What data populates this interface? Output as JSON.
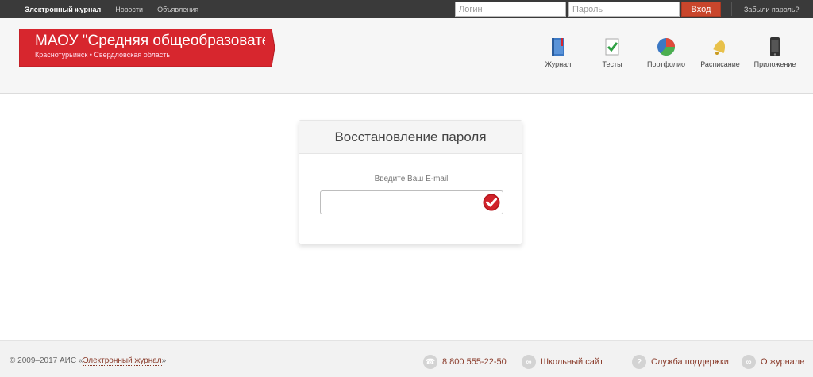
{
  "topbar": {
    "nav": [
      "Электронный журнал",
      "Новости",
      "Объявления"
    ],
    "login_placeholder": "Логин",
    "password_placeholder": "Пароль",
    "enter_label": "Вход",
    "forgot_label": "Забыли пароль?"
  },
  "header": {
    "school_title": "МАОУ \"Средняя общеобразовательная школа",
    "school_location": "Краснотурьинск • Свердловская область",
    "menu": [
      {
        "label": "Журнал",
        "icon": "journal-icon"
      },
      {
        "label": "Тесты",
        "icon": "tests-icon"
      },
      {
        "label": "Портфолио",
        "icon": "portfolio-icon"
      },
      {
        "label": "Расписание",
        "icon": "schedule-bell-icon"
      },
      {
        "label": "Приложение",
        "icon": "phone-app-icon"
      }
    ]
  },
  "recovery": {
    "title": "Восстановление пароля",
    "email_label": "Введите Ваш E-mail",
    "email_value": ""
  },
  "footer": {
    "copyright_prefix": "© 2009–2017 АИС «",
    "copyright_link": "Электронный журнал",
    "copyright_suffix": "»",
    "links": [
      {
        "label": "8 800 555-22-50",
        "icon": "phone-icon"
      },
      {
        "label": "Школьный сайт",
        "icon": "link-icon"
      },
      {
        "label": "Служба поддержки",
        "icon": "help-icon"
      },
      {
        "label": "О журнале",
        "icon": "link-icon"
      }
    ]
  },
  "colors": {
    "topbar_bg": "#3a3a3a",
    "banner_red": "#d7262e",
    "enter_button": "#c9462c",
    "submit_red": "#b3151c"
  }
}
